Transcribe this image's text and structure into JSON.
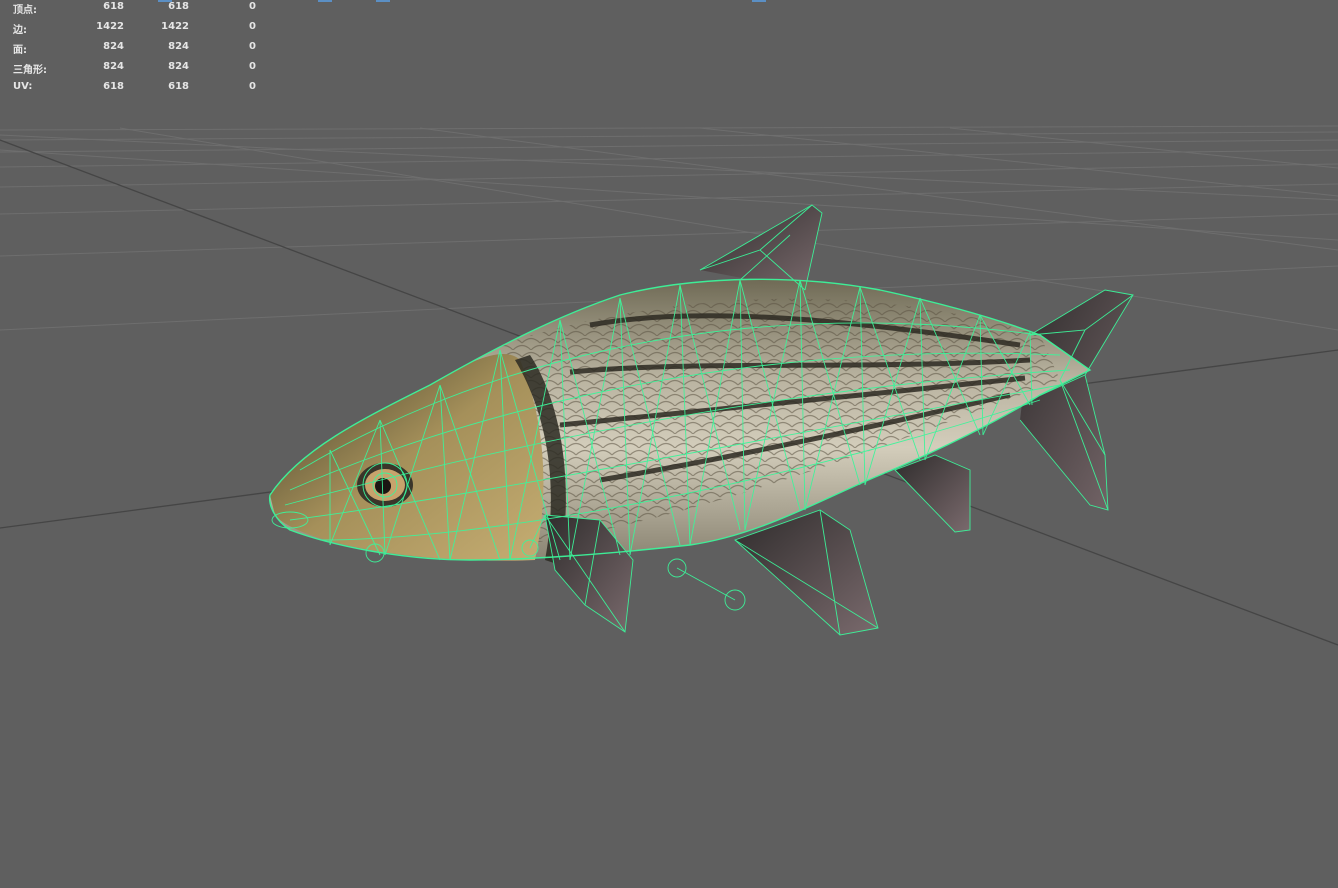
{
  "stats": {
    "rows": [
      {
        "label": "顶点:",
        "values": [
          "618",
          "618",
          "0"
        ]
      },
      {
        "label": "边:",
        "values": [
          "1422",
          "1422",
          "0"
        ]
      },
      {
        "label": "面:",
        "values": [
          "824",
          "824",
          "0"
        ]
      },
      {
        "label": "三角形:",
        "values": [
          "824",
          "824",
          "0"
        ]
      },
      {
        "label": "UV:",
        "values": [
          "618",
          "618",
          "0"
        ]
      }
    ]
  },
  "colors": {
    "viewport_bg": "#5f5f5f",
    "grid": "#6e6e6e",
    "grid_axis": "#3f3f3f",
    "wireframe": "#3cf59a",
    "text": "#e6e6e6"
  },
  "model": {
    "name_icon": "fish-mesh-icon"
  }
}
